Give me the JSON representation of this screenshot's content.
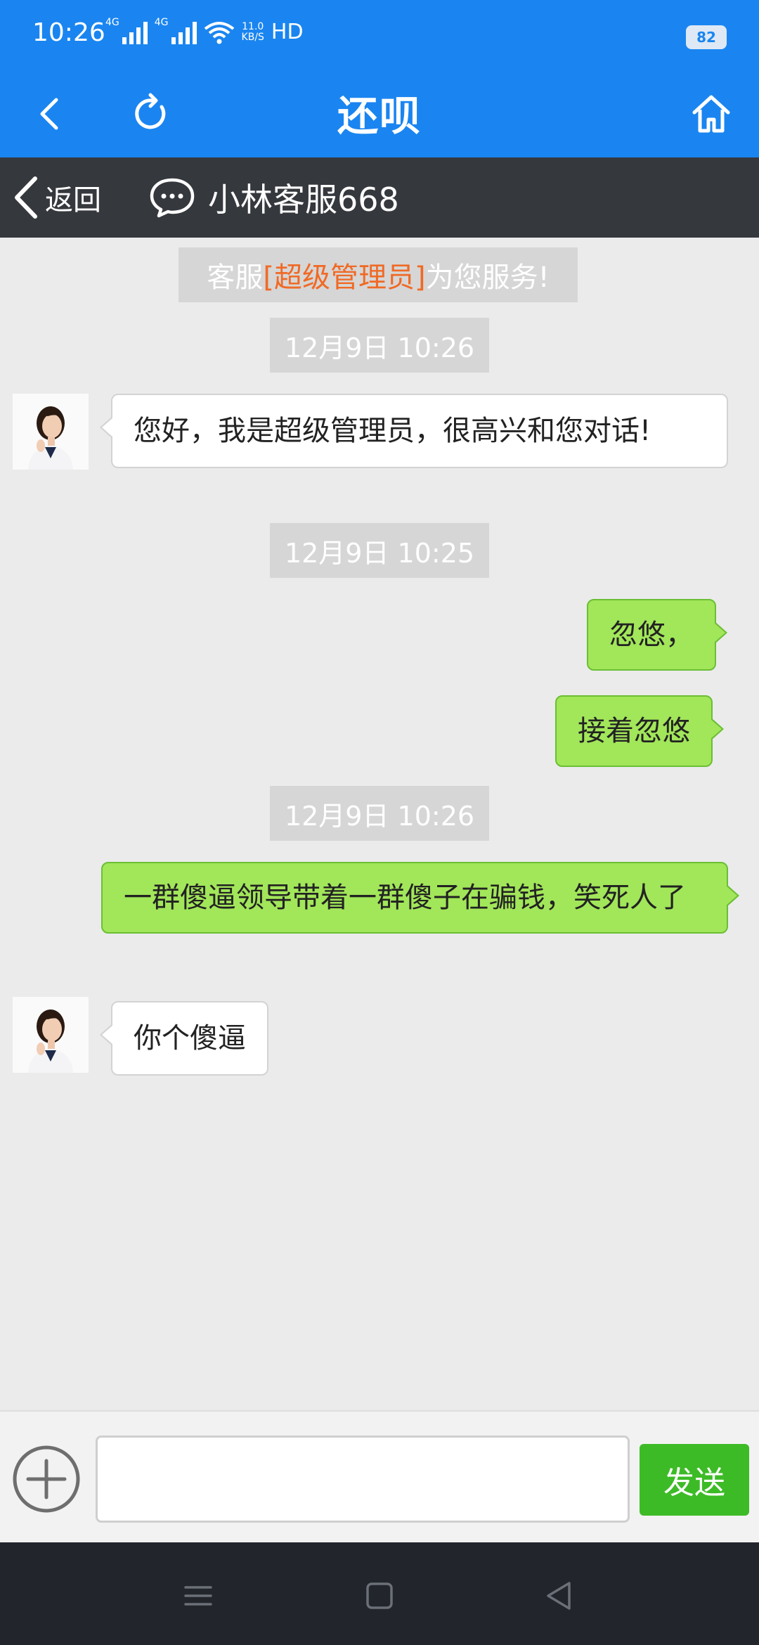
{
  "status_bar": {
    "time": "10:26",
    "signal1_label": "4G",
    "signal2_label": "4G",
    "speed_value": "11.0",
    "speed_unit": "KB/S",
    "hd_label": "HD",
    "battery": "82"
  },
  "nav": {
    "title": "还呗",
    "icons": {
      "back": "chevron-left-icon",
      "refresh": "refresh-icon",
      "home": "home-icon"
    }
  },
  "chat_header": {
    "back_label": "返回",
    "agent_name": "小林客服668",
    "icons": {
      "back": "chevron-left-icon",
      "chat": "chat-bubble-icon"
    }
  },
  "notice": {
    "prefix": "客服",
    "highlight": "[超级管理员]",
    "suffix": "为您服务!",
    "highlight_color": "#f06a25"
  },
  "messages": [
    {
      "type": "time",
      "text": "12月9日 10:26"
    },
    {
      "type": "incoming",
      "text": "您好，我是超级管理员，很高兴和您对话!"
    },
    {
      "type": "time",
      "text": "12月9日 10:25"
    },
    {
      "type": "outgoing",
      "text": "忽悠，"
    },
    {
      "type": "outgoing",
      "text": "接着忽悠"
    },
    {
      "type": "time",
      "text": "12月9日 10:26"
    },
    {
      "type": "outgoing",
      "text": "一群傻逼领导带着一群傻子在骗钱，笑死人了"
    },
    {
      "type": "incoming",
      "text": "你个傻逼"
    }
  ],
  "input_bar": {
    "placeholder": "",
    "value": "",
    "send_label": "发送",
    "plus_icon": "plus-circle-icon"
  },
  "system_nav": {
    "icons": [
      "menu-icon",
      "square-home-icon",
      "triangle-back-icon"
    ]
  },
  "colors": {
    "primary_blue": "#1a85f0",
    "dark_bar": "#35383d",
    "chat_background": "#ebebeb",
    "outgoing_bubble": "#a2e65a",
    "send_button": "#3dbb26"
  }
}
